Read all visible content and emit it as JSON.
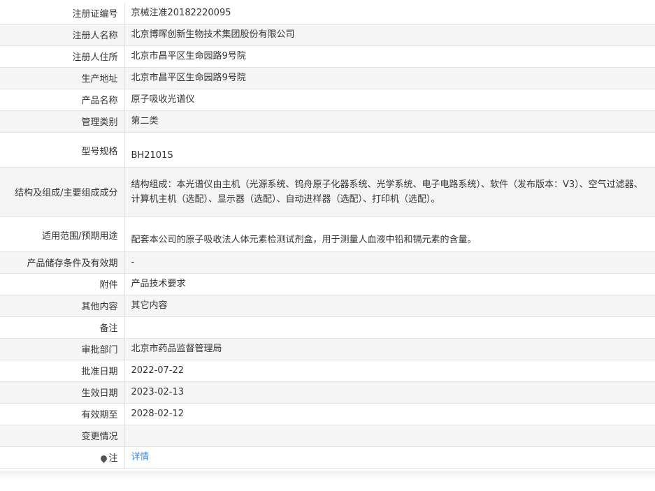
{
  "rows": [
    {
      "label": "注册证编号",
      "value": "京械注准20182220095"
    },
    {
      "label": "注册人名称",
      "value": "北京博晖创新生物技术集团股份有限公司"
    },
    {
      "label": "注册人住所",
      "value": "北京市昌平区生命园路9号院"
    },
    {
      "label": "生产地址",
      "value": "北京市昌平区生命园路9号院"
    },
    {
      "label": "产品名称",
      "value": "原子吸收光谱仪"
    },
    {
      "label": "管理类别",
      "value": "第二类"
    },
    {
      "label": "型号规格",
      "value": "BH2101S"
    },
    {
      "label": "结构及组成/主要组成成分",
      "value": "结构组成：本光谱仪由主机（光源系统、钨舟原子化器系统、光学系统、电子电路系统）、软件（发布版本：V3）、空气过滤器、计算机主机（选配）、显示器（选配）、自动进样器（选配）、打印机（选配）。"
    },
    {
      "label": "适用范围/预期用途",
      "value": "配套本公司的原子吸收法人体元素检测试剂盒，用于测量人血液中铅和镉元素的含量。"
    },
    {
      "label": "产品储存条件及有效期",
      "value": "-"
    },
    {
      "label": "附件",
      "value": "产品技术要求"
    },
    {
      "label": "其他内容",
      "value": "其它内容"
    },
    {
      "label": "备注",
      "value": ""
    },
    {
      "label": "审批部门",
      "value": "北京市药品监督管理局"
    },
    {
      "label": "批准日期",
      "value": "2022-07-22"
    },
    {
      "label": "生效日期",
      "value": "2023-02-13"
    },
    {
      "label": "有效期至",
      "value": "2028-02-12"
    },
    {
      "label": "变更情况",
      "value": ""
    },
    {
      "label": "注",
      "value": "详情",
      "icon": "pin-icon"
    }
  ]
}
